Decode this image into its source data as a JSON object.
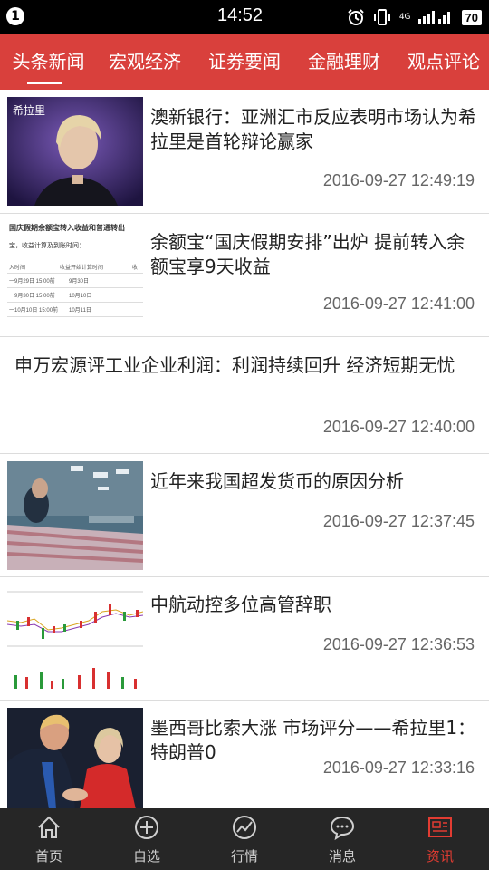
{
  "status_bar": {
    "notification_count": "1",
    "time": "14:52",
    "network": "4G",
    "battery": "70",
    "icons": [
      "alarm-icon",
      "vibrate-icon",
      "signal-icon",
      "battery-icon"
    ]
  },
  "tabs": [
    {
      "label": "头条新闻",
      "active": true
    },
    {
      "label": "宏观经济",
      "active": false
    },
    {
      "label": "证券要闻",
      "active": false
    },
    {
      "label": "金融理财",
      "active": false
    },
    {
      "label": "观点评论",
      "active": false
    }
  ],
  "news": [
    {
      "title": "澳新银行：亚洲汇市反应表明市场认为希拉里是首轮辩论赢家",
      "time": "2016-09-27 12:49:19",
      "thumbnail": "portrait-photo",
      "thumb_caption": "希拉里"
    },
    {
      "title": "余额宝“国庆假期安排”出炉 提前转入余额宝享9天收益",
      "time": "2016-09-27 12:41:00",
      "thumbnail": "table-screenshot",
      "thumb_table": {
        "heading": "国庆假期余额宝转入收益和普通转出",
        "subheading": "宝，收益计算及到账时间：",
        "columns": [
          "入时间",
          "收益开始计算时间",
          "收"
        ],
        "rows": [
          [
            "一9月29日 15:00前",
            "9月30日"
          ],
          [
            "一9月30日 15:00前",
            "10月10日"
          ],
          [
            "一10月10日 15:00前",
            "10月11日"
          ]
        ]
      }
    },
    {
      "title": "申万宏源评工业企业利润：利润持续回升 经济短期无忧",
      "time": "2016-09-27 12:40:00",
      "thumbnail": null
    },
    {
      "title": "近年来我国超发货币的原因分析",
      "time": "2016-09-27 12:37:45",
      "thumbnail": "money-printing-photo"
    },
    {
      "title": "中航动控多位高管辞职",
      "time": "2016-09-27 12:36:53",
      "thumbnail": "stock-chart"
    },
    {
      "title": "墨西哥比索大涨 市场评分——希拉里1：特朗普0",
      "time": "2016-09-27 12:33:16",
      "thumbnail": "handshake-photo"
    }
  ],
  "bottom_nav": [
    {
      "label": "首页",
      "icon": "home-icon",
      "active": false
    },
    {
      "label": "自选",
      "icon": "plus-circle-icon",
      "active": false
    },
    {
      "label": "行情",
      "icon": "trend-icon",
      "active": false
    },
    {
      "label": "消息",
      "icon": "message-icon",
      "active": false
    },
    {
      "label": "资讯",
      "icon": "news-icon",
      "active": true
    }
  ],
  "colors": {
    "accent": "#d9403c",
    "active_nav": "#e23c32",
    "nav_bg": "#262626"
  }
}
